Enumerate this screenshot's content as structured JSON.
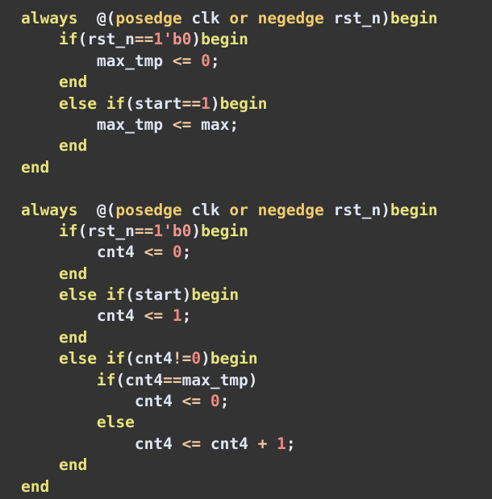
{
  "editor": {
    "background_color": "#333334",
    "font_size_px": 19.5,
    "line_height_px": 26.4,
    "language": "verilog",
    "tab_width_spaces": 4
  },
  "colors": {
    "keyword": "#e8e47a",
    "edge_keyword": "#f2cd6b",
    "identifier": "#e8eaf0",
    "punctuation": "#e6e8ee",
    "number": "#ef8a80",
    "operator": "#f0c9a0",
    "base_literal": "#f0968e",
    "background": "#333334"
  },
  "code": {
    "lines": [
      {
        "n": 1,
        "text": "always  @(posedge clk or negedge rst_n)begin",
        "tokens": [
          {
            "t": "always",
            "c": "kw"
          },
          {
            "t": "  ",
            "c": "punct"
          },
          {
            "t": "@(",
            "c": "punct"
          },
          {
            "t": "posedge",
            "c": "edge"
          },
          {
            "t": " ",
            "c": "punct"
          },
          {
            "t": "clk",
            "c": "var"
          },
          {
            "t": " ",
            "c": "punct"
          },
          {
            "t": "or",
            "c": "edge"
          },
          {
            "t": " ",
            "c": "punct"
          },
          {
            "t": "negedge",
            "c": "edge"
          },
          {
            "t": " ",
            "c": "punct"
          },
          {
            "t": "rst_n",
            "c": "var"
          },
          {
            "t": ")",
            "c": "punct"
          },
          {
            "t": "begin",
            "c": "kw"
          }
        ]
      },
      {
        "n": 2,
        "text": "    if(rst_n==1'b0)begin",
        "tokens": [
          {
            "t": "    ",
            "c": "punct"
          },
          {
            "t": "if",
            "c": "kw"
          },
          {
            "t": "(",
            "c": "punct"
          },
          {
            "t": "rst_n",
            "c": "var"
          },
          {
            "t": "==",
            "c": "op"
          },
          {
            "t": "1",
            "c": "num"
          },
          {
            "t": "'b0",
            "c": "base"
          },
          {
            "t": ")",
            "c": "punct"
          },
          {
            "t": "begin",
            "c": "kw"
          }
        ]
      },
      {
        "n": 3,
        "text": "        max_tmp <= 0;",
        "tokens": [
          {
            "t": "        ",
            "c": "punct"
          },
          {
            "t": "max_tmp",
            "c": "var"
          },
          {
            "t": " ",
            "c": "punct"
          },
          {
            "t": "<=",
            "c": "op"
          },
          {
            "t": " ",
            "c": "punct"
          },
          {
            "t": "0",
            "c": "num"
          },
          {
            "t": ";",
            "c": "punct"
          }
        ]
      },
      {
        "n": 4,
        "text": "    end",
        "tokens": [
          {
            "t": "    ",
            "c": "punct"
          },
          {
            "t": "end",
            "c": "kw"
          }
        ]
      },
      {
        "n": 5,
        "text": "    else if(start==1)begin",
        "tokens": [
          {
            "t": "    ",
            "c": "punct"
          },
          {
            "t": "else",
            "c": "kw"
          },
          {
            "t": " ",
            "c": "punct"
          },
          {
            "t": "if",
            "c": "kw"
          },
          {
            "t": "(",
            "c": "punct"
          },
          {
            "t": "start",
            "c": "var"
          },
          {
            "t": "==",
            "c": "op"
          },
          {
            "t": "1",
            "c": "num"
          },
          {
            "t": ")",
            "c": "punct"
          },
          {
            "t": "begin",
            "c": "kw"
          }
        ]
      },
      {
        "n": 6,
        "text": "        max_tmp <= max;",
        "tokens": [
          {
            "t": "        ",
            "c": "punct"
          },
          {
            "t": "max_tmp",
            "c": "var"
          },
          {
            "t": " ",
            "c": "punct"
          },
          {
            "t": "<=",
            "c": "op"
          },
          {
            "t": " ",
            "c": "punct"
          },
          {
            "t": "max",
            "c": "var"
          },
          {
            "t": ";",
            "c": "punct"
          }
        ]
      },
      {
        "n": 7,
        "text": "    end",
        "tokens": [
          {
            "t": "    ",
            "c": "punct"
          },
          {
            "t": "end",
            "c": "kw"
          }
        ]
      },
      {
        "n": 8,
        "text": "end",
        "tokens": [
          {
            "t": "end",
            "c": "kw"
          }
        ]
      },
      {
        "n": 9,
        "text": "",
        "tokens": []
      },
      {
        "n": 10,
        "text": "always  @(posedge clk or negedge rst_n)begin",
        "tokens": [
          {
            "t": "always",
            "c": "kw"
          },
          {
            "t": "  ",
            "c": "punct"
          },
          {
            "t": "@(",
            "c": "punct"
          },
          {
            "t": "posedge",
            "c": "edge"
          },
          {
            "t": " ",
            "c": "punct"
          },
          {
            "t": "clk",
            "c": "var"
          },
          {
            "t": " ",
            "c": "punct"
          },
          {
            "t": "or",
            "c": "edge"
          },
          {
            "t": " ",
            "c": "punct"
          },
          {
            "t": "negedge",
            "c": "edge"
          },
          {
            "t": " ",
            "c": "punct"
          },
          {
            "t": "rst_n",
            "c": "var"
          },
          {
            "t": ")",
            "c": "punct"
          },
          {
            "t": "begin",
            "c": "kw"
          }
        ]
      },
      {
        "n": 11,
        "text": "    if(rst_n==1'b0)begin",
        "tokens": [
          {
            "t": "    ",
            "c": "punct"
          },
          {
            "t": "if",
            "c": "kw"
          },
          {
            "t": "(",
            "c": "punct"
          },
          {
            "t": "rst_n",
            "c": "var"
          },
          {
            "t": "==",
            "c": "op"
          },
          {
            "t": "1",
            "c": "num"
          },
          {
            "t": "'b0",
            "c": "base"
          },
          {
            "t": ")",
            "c": "punct"
          },
          {
            "t": "begin",
            "c": "kw"
          }
        ]
      },
      {
        "n": 12,
        "text": "        cnt4 <= 0;",
        "tokens": [
          {
            "t": "        ",
            "c": "punct"
          },
          {
            "t": "cnt4",
            "c": "var"
          },
          {
            "t": " ",
            "c": "punct"
          },
          {
            "t": "<=",
            "c": "op"
          },
          {
            "t": " ",
            "c": "punct"
          },
          {
            "t": "0",
            "c": "num"
          },
          {
            "t": ";",
            "c": "punct"
          }
        ]
      },
      {
        "n": 13,
        "text": "    end",
        "tokens": [
          {
            "t": "    ",
            "c": "punct"
          },
          {
            "t": "end",
            "c": "kw"
          }
        ]
      },
      {
        "n": 14,
        "text": "    else if(start)begin",
        "tokens": [
          {
            "t": "    ",
            "c": "punct"
          },
          {
            "t": "else",
            "c": "kw"
          },
          {
            "t": " ",
            "c": "punct"
          },
          {
            "t": "if",
            "c": "kw"
          },
          {
            "t": "(",
            "c": "punct"
          },
          {
            "t": "start",
            "c": "var"
          },
          {
            "t": ")",
            "c": "punct"
          },
          {
            "t": "begin",
            "c": "kw"
          }
        ]
      },
      {
        "n": 15,
        "text": "        cnt4 <= 1;",
        "tokens": [
          {
            "t": "        ",
            "c": "punct"
          },
          {
            "t": "cnt4",
            "c": "var"
          },
          {
            "t": " ",
            "c": "punct"
          },
          {
            "t": "<=",
            "c": "op"
          },
          {
            "t": " ",
            "c": "punct"
          },
          {
            "t": "1",
            "c": "num"
          },
          {
            "t": ";",
            "c": "punct"
          }
        ]
      },
      {
        "n": 16,
        "text": "    end",
        "tokens": [
          {
            "t": "    ",
            "c": "punct"
          },
          {
            "t": "end",
            "c": "kw"
          }
        ]
      },
      {
        "n": 17,
        "text": "    else if(cnt4!=0)begin",
        "tokens": [
          {
            "t": "    ",
            "c": "punct"
          },
          {
            "t": "else",
            "c": "kw"
          },
          {
            "t": " ",
            "c": "punct"
          },
          {
            "t": "if",
            "c": "kw"
          },
          {
            "t": "(",
            "c": "punct"
          },
          {
            "t": "cnt4",
            "c": "var"
          },
          {
            "t": "!=",
            "c": "op"
          },
          {
            "t": "0",
            "c": "num"
          },
          {
            "t": ")",
            "c": "punct"
          },
          {
            "t": "begin",
            "c": "kw"
          }
        ]
      },
      {
        "n": 18,
        "text": "        if(cnt4==max_tmp)",
        "tokens": [
          {
            "t": "        ",
            "c": "punct"
          },
          {
            "t": "if",
            "c": "kw"
          },
          {
            "t": "(",
            "c": "punct"
          },
          {
            "t": "cnt4",
            "c": "var"
          },
          {
            "t": "==",
            "c": "op"
          },
          {
            "t": "max_tmp",
            "c": "var"
          },
          {
            "t": ")",
            "c": "punct"
          }
        ]
      },
      {
        "n": 19,
        "text": "            cnt4 <= 0;",
        "tokens": [
          {
            "t": "            ",
            "c": "punct"
          },
          {
            "t": "cnt4",
            "c": "var"
          },
          {
            "t": " ",
            "c": "punct"
          },
          {
            "t": "<=",
            "c": "op"
          },
          {
            "t": " ",
            "c": "punct"
          },
          {
            "t": "0",
            "c": "num"
          },
          {
            "t": ";",
            "c": "punct"
          }
        ]
      },
      {
        "n": 20,
        "text": "        else",
        "tokens": [
          {
            "t": "        ",
            "c": "punct"
          },
          {
            "t": "else",
            "c": "kw"
          }
        ]
      },
      {
        "n": 21,
        "text": "            cnt4 <= cnt4 + 1;",
        "tokens": [
          {
            "t": "            ",
            "c": "punct"
          },
          {
            "t": "cnt4",
            "c": "var"
          },
          {
            "t": " ",
            "c": "punct"
          },
          {
            "t": "<=",
            "c": "op"
          },
          {
            "t": " ",
            "c": "punct"
          },
          {
            "t": "cnt4",
            "c": "var"
          },
          {
            "t": " ",
            "c": "punct"
          },
          {
            "t": "+",
            "c": "op"
          },
          {
            "t": " ",
            "c": "punct"
          },
          {
            "t": "1",
            "c": "num"
          },
          {
            "t": ";",
            "c": "punct"
          }
        ]
      },
      {
        "n": 22,
        "text": "    end",
        "tokens": [
          {
            "t": "    ",
            "c": "punct"
          },
          {
            "t": "end",
            "c": "kw"
          }
        ]
      },
      {
        "n": 23,
        "text": "end",
        "tokens": [
          {
            "t": "end",
            "c": "kw"
          }
        ]
      }
    ]
  }
}
